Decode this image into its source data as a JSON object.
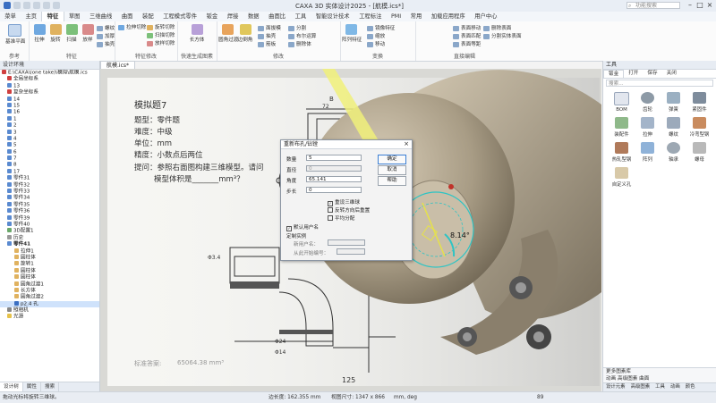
{
  "titlebar": {
    "title": "CAXA 3D 实体设计2025 - [航模.ics*]",
    "search_placeholder": "功能搜索"
  },
  "menu_tabs": [
    "菜单",
    "主页",
    "特征",
    "草图",
    "三维曲线",
    "曲面",
    "装配",
    "工程模式零件",
    "钣金",
    "焊接",
    "仿真",
    "有限元",
    "自由设计",
    "加载应用程序",
    "用户中心"
  ],
  "menu_tabs_display": [
    "菜单",
    "主页",
    "特征",
    "草图",
    "三维曲线",
    "曲面",
    "装配",
    "工程模式零件",
    "钣金",
    "焊接",
    "数据",
    "曲面比",
    "工具",
    "智能设计技术",
    "工程标注",
    "PMI",
    "常用",
    "加载应用程序",
    "用户中心"
  ],
  "active_tab": "特征",
  "ribbon": {
    "groups": [
      {
        "label": "参考",
        "buttons": [
          "基准平面"
        ]
      },
      {
        "label": "特征",
        "buttons": [
          "拉伸",
          "旋转",
          "扫描",
          "放样"
        ],
        "small": [
          "螺纹",
          "加厚",
          "抽壳"
        ]
      },
      {
        "label": "特征修改",
        "small": [
          "拉伸切除",
          "旋转切除",
          "扫描切除",
          "放样切除"
        ]
      },
      {
        "label": "快速生成图素",
        "buttons": [
          "长方体"
        ]
      },
      {
        "label": "修改",
        "buttons": [
          "圆角过渡",
          "边倒角"
        ],
        "small": [
          "面拔模",
          "抽壳",
          "筋板",
          "分割",
          "布尔运算",
          "删除体"
        ]
      },
      {
        "label": "变换",
        "buttons": [
          "阵列特征"
        ],
        "small": [
          "镜像特征",
          "缩放",
          "移动"
        ]
      },
      {
        "label": "直接编辑",
        "small": [
          "表面移动",
          "表面匹配",
          "表面等距",
          "删除表面",
          "分割实体表面"
        ]
      }
    ]
  },
  "left_panel": {
    "title": "设计环境",
    "file_path": "E:\\CAXA\\(one take)\\模拟\\航模.ics",
    "tree": [
      "全局坐标系",
      "13",
      "复杂坐标系",
      "14",
      "15",
      "16",
      "1",
      "2",
      "3",
      "4",
      "5",
      "6",
      "7",
      "8",
      "17",
      "零件31",
      "零件32",
      "零件33",
      "零件34",
      "零件35",
      "零件36",
      "零件39",
      "零件40",
      "3D配置1",
      "历史",
      "零件41",
      "拉伸1",
      "圆柱体",
      "旋转1",
      "圆柱体",
      "圆柱体",
      "圆角过渡1",
      "长方体",
      "圆角过渡2",
      "p2.4 孔",
      "照相机",
      "光源"
    ],
    "tabs": [
      "设计树",
      "属性",
      "搜索"
    ]
  },
  "document_tab": "航模.ics*",
  "sheet": {
    "heading": "模拟题7",
    "lines": [
      "题型：零件题",
      "难度：中级",
      "单位：mm",
      "精度：小数点后两位"
    ],
    "question": "提问：参照右面图构建三维模型。请问",
    "question2": "模型体积是_______mm³？",
    "answer_label": "标准答案:",
    "answer_value": "65064.38 mm³",
    "page_number": "125",
    "dims": [
      "72",
      "B",
      "R",
      "Φ3.4",
      "Φ24",
      "Φ14"
    ]
  },
  "angle_label": "8.14°",
  "dialog": {
    "title": "重新布孔/钻镗",
    "fields": [
      {
        "label": "数量",
        "value": "5"
      },
      {
        "label": "直径",
        "value": "0"
      },
      {
        "label": "角度",
        "value": "65.141"
      },
      {
        "label": "步长",
        "value": "0"
      }
    ],
    "ok_label": "确定",
    "cancel_label": "取消",
    "help_label": "帮助",
    "checks": [
      {
        "label": "重设三维球",
        "checked": true
      },
      {
        "label": "反转方向后重置",
        "checked": false
      },
      {
        "label": "平均分配",
        "checked": false
      }
    ],
    "default_check": "默认用户名",
    "section_label": "定制实例",
    "name_label": "新用户名：",
    "from_label": "从此开始编号："
  },
  "right_panel": {
    "title": "工具",
    "tabs": [
      "钣金",
      "打开",
      "保存",
      "关闭"
    ],
    "search_placeholder": "搜索...",
    "tools": [
      "BOM",
      "齿轮",
      "弹簧",
      "紧固件",
      "装配件",
      "拉伸",
      "螺纹",
      "冷弯型钢",
      "热轧型钢",
      "阵列",
      "轴承",
      "螺母",
      "自定义孔"
    ],
    "sub_title": "更多图素库",
    "library_items": [
      "动画",
      "高级图素",
      "曲面"
    ],
    "bottom_tabs": [
      "设计元素",
      "高级图素",
      "工具",
      "动画",
      "颜色"
    ]
  },
  "statusbar": {
    "hint": "拖动光标将旋转三维球。",
    "length": "边长度: 162.355 mm",
    "view_size": "视图尺寸: 1347 x 866",
    "unit": "mm, deg",
    "extra": "89"
  }
}
